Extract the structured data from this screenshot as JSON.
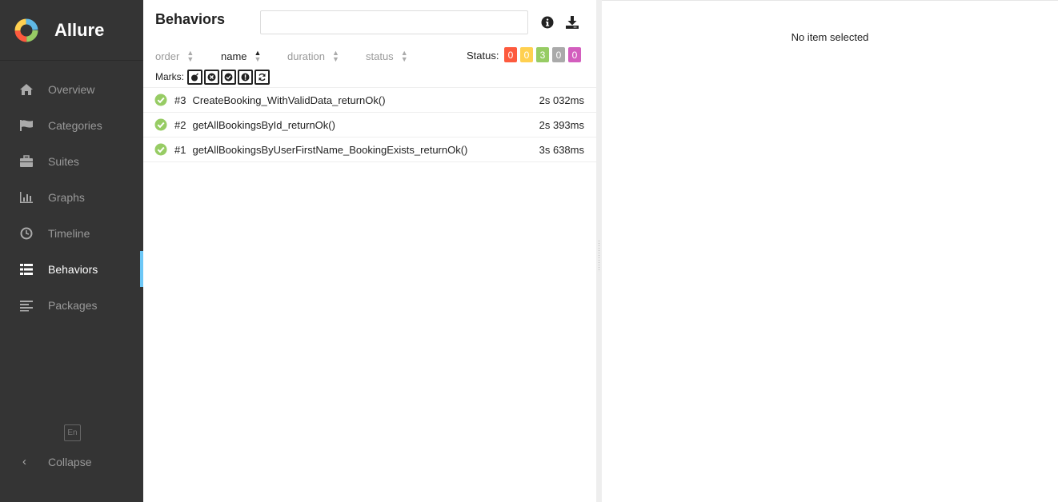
{
  "brand": {
    "name": "Allure"
  },
  "sidebar": {
    "items": [
      {
        "label": "Overview",
        "icon": "home-icon",
        "active": false
      },
      {
        "label": "Categories",
        "icon": "flag-icon",
        "active": false
      },
      {
        "label": "Suites",
        "icon": "briefcase-icon",
        "active": false
      },
      {
        "label": "Graphs",
        "icon": "bar-chart-icon",
        "active": false
      },
      {
        "label": "Timeline",
        "icon": "clock-icon",
        "active": false
      },
      {
        "label": "Behaviors",
        "icon": "list-icon",
        "active": true
      },
      {
        "label": "Packages",
        "icon": "align-left-icon",
        "active": false
      }
    ],
    "language": "En",
    "collapse_label": "Collapse"
  },
  "tree": {
    "title": "Behaviors",
    "search": {
      "placeholder": "",
      "value": ""
    },
    "sort": {
      "order": "order",
      "name": "name",
      "duration": "duration",
      "status": "status",
      "active": "name"
    },
    "status_label": "Status:",
    "status_counts": [
      {
        "value": "0",
        "color": "#fd5a3e"
      },
      {
        "value": "0",
        "color": "#ffd050"
      },
      {
        "value": "3",
        "color": "#97cc64"
      },
      {
        "value": "0",
        "color": "#aaaaaa"
      },
      {
        "value": "0",
        "color": "#d35ebe"
      }
    ],
    "marks_label": "Marks:",
    "marks": [
      "bomb-icon",
      "times-circle-icon",
      "check-circle-icon",
      "exclamation-circle-icon",
      "refresh-icon"
    ],
    "rows": [
      {
        "order": "#3",
        "name": "CreateBooking_WithValidData_returnOk()",
        "duration": "2s 032ms",
        "status": "passed"
      },
      {
        "order": "#2",
        "name": "getAllBookingsById_returnOk()",
        "duration": "2s 393ms",
        "status": "passed"
      },
      {
        "order": "#1",
        "name": "getAllBookingsByUserFirstName_BookingExists_returnOk()",
        "duration": "3s 638ms",
        "status": "passed"
      }
    ]
  },
  "detail": {
    "empty_text": "No item selected"
  },
  "colors": {
    "sidebar_bg": "#343434",
    "active_accent": "#6cc7f6",
    "passed": "#97cc64"
  }
}
